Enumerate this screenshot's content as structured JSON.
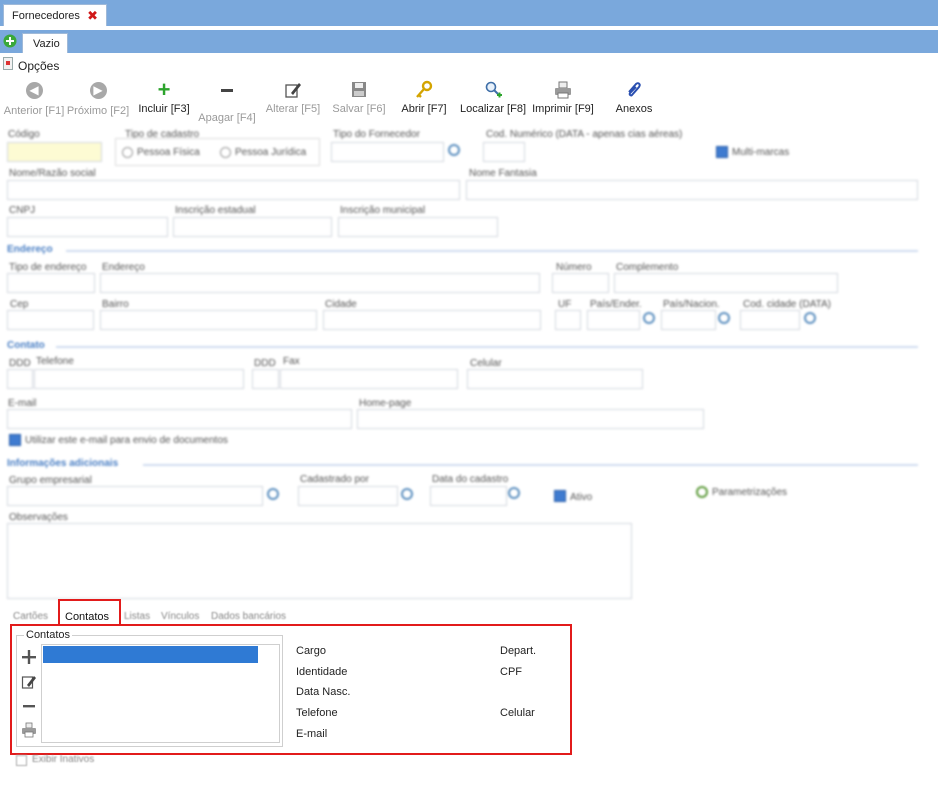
{
  "tabs": {
    "document_tab": "Fornecedores",
    "sub_tab": "Vazio"
  },
  "menu": {
    "options": "Opções"
  },
  "toolbar": [
    {
      "name": "previous-button",
      "label": "Anterior [F1]",
      "icon": "arrow-left-icon",
      "enabled": false
    },
    {
      "name": "next-button",
      "label": "Próximo [F2]",
      "icon": "arrow-right-icon",
      "enabled": false
    },
    {
      "name": "include-button",
      "label": "Incluir [F3]",
      "icon": "plus-icon",
      "enabled": true
    },
    {
      "name": "delete-button",
      "label": "Apagar [F4]",
      "icon": "minus-icon",
      "enabled": false
    },
    {
      "name": "edit-button",
      "label": "Alterar [F5]",
      "icon": "pencil-icon",
      "enabled": false
    },
    {
      "name": "save-button",
      "label": "Salvar [F6]",
      "icon": "floppy-icon",
      "enabled": false
    },
    {
      "name": "open-button",
      "label": "Abrir [F7]",
      "icon": "key-icon",
      "enabled": true
    },
    {
      "name": "locate-button",
      "label": "Localizar [F8]",
      "icon": "search-icon",
      "enabled": true
    },
    {
      "name": "print-button",
      "label": "Imprimir [F9]",
      "icon": "printer-icon",
      "enabled": true
    },
    {
      "name": "attachments-button",
      "label": "Anexos",
      "icon": "paperclip-icon",
      "enabled": true
    }
  ],
  "form": {
    "codigo": "Código",
    "tipo_cadastro": "Tipo de cadastro",
    "pessoa_fisica": "Pessoa Física",
    "pessoa_juridica": "Pessoa Jurídica",
    "tipo_fornecedor": "Tipo do Fornecedor",
    "cod_numerico": "Cod. Numérico (DATA - apenas cias aéreas)",
    "multi_marcas": "Multi-marcas",
    "nome_razao": "Nome/Razão social",
    "nome_fantasia": "Nome Fantasia",
    "cnpj": "CNPJ",
    "inscricao_estadual": "Inscrição estadual",
    "inscricao_municipal": "Inscrição municipal",
    "endereco_section": "Endereço",
    "tipo_endereco": "Tipo de endereço",
    "endereco": "Endereço",
    "numero": "Número",
    "complemento": "Complemento",
    "cep": "Cep",
    "bairro": "Bairro",
    "cidade": "Cidade",
    "uf": "UF",
    "pais_ender": "País/Ender.",
    "pais_nacion": "País/Nacion.",
    "cod_cidade": "Cod. cidade (DATA)",
    "contato_section": "Contato",
    "ddd1": "DDD",
    "telefone": "Telefone",
    "ddd2": "DDD",
    "fax": "Fax",
    "celular": "Celular",
    "email": "E-mail",
    "home_page": "Home-page",
    "usar_email": "Utilizar este e-mail para envio de documentos",
    "info_section": "Informações adicionais",
    "grupo_empresarial": "Grupo empresarial",
    "cadastrado_por": "Cadastrado por",
    "data_cadastro": "Data do cadastro",
    "ativo": "Ativo",
    "parametrizacoes": "Parametrizações",
    "observacoes": "Observações"
  },
  "bottom_tabs": [
    "Cartões",
    "Contatos",
    "Listas",
    "Vínculos",
    "Dados bancários"
  ],
  "contacts": {
    "group_title": "Contatos",
    "labels_left": [
      "Cargo",
      "Identidade",
      "Data Nasc.",
      "Telefone",
      "E-mail"
    ],
    "labels_right": [
      "Depart.",
      "CPF",
      "",
      "Celular",
      ""
    ],
    "show_inactive": "Exibir Inativos"
  },
  "colors": {
    "title_bar": "#7aa8dc",
    "highlight_border": "#e21b1b",
    "selection": "#2f7ad4",
    "required_field": "#fdfbd3"
  }
}
